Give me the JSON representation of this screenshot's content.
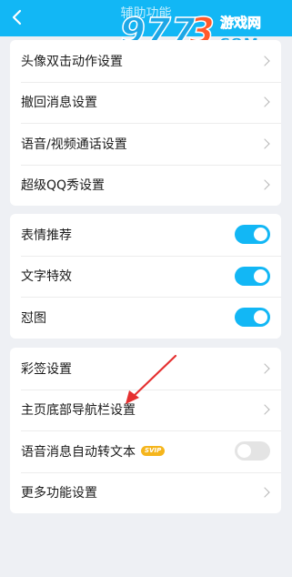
{
  "header": {
    "title": "辅助功能",
    "back_icon": "chevron-left-icon",
    "color": "#12b7f5"
  },
  "watermark": {
    "text": "9773 游戏网 COM"
  },
  "group1": [
    {
      "label": "头像双击动作设置"
    },
    {
      "label": "撤回消息设置"
    },
    {
      "label": "语音/视频通话设置"
    },
    {
      "label": "超级QQ秀设置"
    }
  ],
  "group2": [
    {
      "label": "表情推荐",
      "enabled": true
    },
    {
      "label": "文字特效",
      "enabled": true
    },
    {
      "label": "怼图",
      "enabled": true
    }
  ],
  "group3": {
    "signature": {
      "label": "彩签设置"
    },
    "bottom_nav": {
      "label": "主页底部导航栏设置"
    },
    "voice_to_text": {
      "label": "语音消息自动转文本",
      "badge": "SVIP",
      "enabled": false
    },
    "more": {
      "label": "更多功能设置"
    }
  },
  "annotation": {
    "arrow_color": "#e53030"
  }
}
